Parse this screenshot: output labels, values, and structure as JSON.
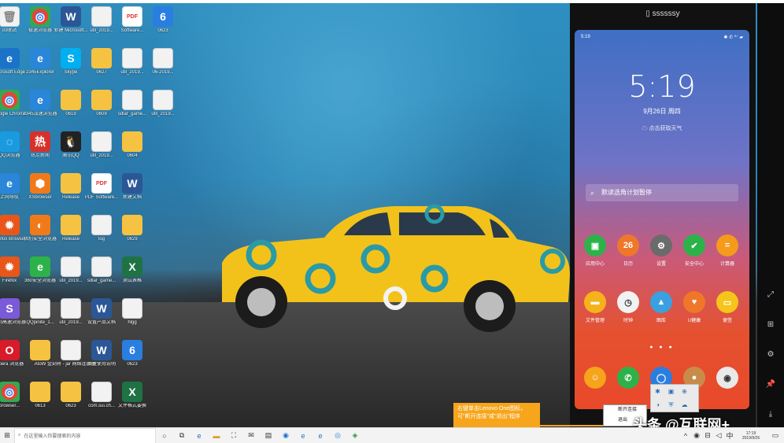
{
  "desktop": {
    "icons": [
      {
        "label": "回收站",
        "glyph": "🗑",
        "kind": "doc",
        "col": 0,
        "row": 0
      },
      {
        "label": "极速浏览器",
        "glyph": "◎",
        "kind": "chrome",
        "col": 1,
        "row": 0
      },
      {
        "label": "新建 Microsoft...",
        "glyph": "W",
        "kind": "word",
        "col": 2,
        "row": 0
      },
      {
        "label": "util_2019...",
        "glyph": "",
        "kind": "doc",
        "col": 3,
        "row": 0
      },
      {
        "label": "Software...",
        "glyph": "PDF",
        "kind": "pdf",
        "col": 4,
        "row": 0
      },
      {
        "label": "0623",
        "glyph": "6",
        "kind": "blue",
        "col": 5,
        "row": 0
      },
      {
        "label": "Microsoft Edge",
        "glyph": "e",
        "kind": "edge",
        "col": 0,
        "row": 1
      },
      {
        "label": "2345Explorer",
        "glyph": "e",
        "kind": "ie",
        "col": 1,
        "row": 1
      },
      {
        "label": "Skype",
        "glyph": "S",
        "kind": "skype",
        "col": 2,
        "row": 1
      },
      {
        "label": "0627",
        "glyph": "",
        "kind": "fold",
        "col": 3,
        "row": 1
      },
      {
        "label": "util_2019...",
        "glyph": "",
        "kind": "doc",
        "col": 4,
        "row": 1
      },
      {
        "label": "06-2019...",
        "glyph": "",
        "kind": "doc",
        "col": 5,
        "row": 1
      },
      {
        "label": "Google Chrome",
        "glyph": "◎",
        "kind": "chrome",
        "col": 0,
        "row": 2
      },
      {
        "label": "2345加速浏览器",
        "glyph": "e",
        "kind": "ie",
        "col": 1,
        "row": 2
      },
      {
        "label": "0619",
        "glyph": "",
        "kind": "fold",
        "col": 2,
        "row": 2
      },
      {
        "label": "0609",
        "glyph": "",
        "kind": "fold",
        "col": 3,
        "row": 2
      },
      {
        "label": "sdlar_game...",
        "glyph": "",
        "kind": "doc",
        "col": 4,
        "row": 2
      },
      {
        "label": "util_2019...",
        "glyph": "",
        "kind": "doc",
        "col": 5,
        "row": 2
      },
      {
        "label": "QQ浏览器",
        "glyph": "◌",
        "kind": "qqb",
        "col": 0,
        "row": 3
      },
      {
        "label": "热点新闻",
        "glyph": "热",
        "kind": "red",
        "col": 1,
        "row": 3
      },
      {
        "label": "腾讯QQ",
        "glyph": "🐧",
        "kind": "qq",
        "col": 2,
        "row": 3
      },
      {
        "label": "util_2019...",
        "glyph": "",
        "kind": "doc",
        "col": 3,
        "row": 3
      },
      {
        "label": "0604",
        "glyph": "",
        "kind": "fold",
        "col": 4,
        "row": 3
      },
      {
        "label": "上网导航",
        "glyph": "e",
        "kind": "ie",
        "col": 0,
        "row": 4
      },
      {
        "label": "XSbrowser",
        "glyph": "⬢",
        "kind": "orange",
        "col": 1,
        "row": 4
      },
      {
        "label": "Release",
        "glyph": "",
        "kind": "fold",
        "col": 2,
        "row": 4
      },
      {
        "label": "PDF Software...",
        "glyph": "PDF",
        "kind": "pdf",
        "col": 3,
        "row": 4
      },
      {
        "label": "新建文档",
        "glyph": "W",
        "kind": "word",
        "col": 4,
        "row": 4
      },
      {
        "label": "Firefox Browser",
        "glyph": "✹",
        "kind": "firefox",
        "col": 0,
        "row": 5
      },
      {
        "label": "猎豹安全浏览器",
        "glyph": "◐",
        "kind": "orange",
        "col": 1,
        "row": 5
      },
      {
        "label": "Release",
        "glyph": "",
        "kind": "fold",
        "col": 2,
        "row": 5
      },
      {
        "label": "log",
        "glyph": "",
        "kind": "doc",
        "col": 3,
        "row": 5
      },
      {
        "label": "0629",
        "glyph": "",
        "kind": "fold",
        "col": 4,
        "row": 5
      },
      {
        "label": "Firefox",
        "glyph": "✹",
        "kind": "firefox",
        "col": 0,
        "row": 6
      },
      {
        "label": "360安全浏览器",
        "glyph": "e",
        "kind": "green",
        "col": 1,
        "row": 6
      },
      {
        "label": "util_2019...",
        "glyph": "",
        "kind": "doc",
        "col": 2,
        "row": 6
      },
      {
        "label": "sdlar_game...",
        "glyph": "",
        "kind": "doc",
        "col": 3,
        "row": 6
      },
      {
        "label": "测试表格",
        "glyph": "X",
        "kind": "xls",
        "col": 4,
        "row": 6
      },
      {
        "label": "搜狗高速浏览器",
        "glyph": "S",
        "kind": "multi",
        "col": 0,
        "row": 7
      },
      {
        "label": "QQpinite_1...",
        "glyph": "",
        "kind": "doc",
        "col": 1,
        "row": 7
      },
      {
        "label": "util_2019...",
        "glyph": "",
        "kind": "doc",
        "col": 2,
        "row": 7
      },
      {
        "label": "设置产品文档",
        "glyph": "W",
        "kind": "word",
        "col": 3,
        "row": 7
      },
      {
        "label": "hlgg",
        "glyph": "",
        "kind": "doc",
        "col": 4,
        "row": 7
      },
      {
        "label": "Opera 浏览器",
        "glyph": "O",
        "kind": "opera",
        "col": 0,
        "row": 8
      },
      {
        "label": "AtoW",
        "glyph": "",
        "kind": "fold",
        "col": 1,
        "row": 8
      },
      {
        "label": "金刻将 - jar 网络连接器",
        "glyph": "",
        "kind": "doc",
        "col": 2,
        "row": 8
      },
      {
        "label": "质量使用说明",
        "glyph": "W",
        "kind": "word",
        "col": 3,
        "row": 8
      },
      {
        "label": "0623",
        "glyph": "6",
        "kind": "blue",
        "col": 4,
        "row": 8
      },
      {
        "label": "browser...",
        "glyph": "◎",
        "kind": "chrome",
        "col": 0,
        "row": 9
      },
      {
        "label": "0613",
        "glyph": "",
        "kind": "fold",
        "col": 1,
        "row": 9
      },
      {
        "label": "0623",
        "glyph": "",
        "kind": "fold",
        "col": 2,
        "row": 9
      },
      {
        "label": "com.sui.ch...",
        "glyph": "",
        "kind": "doc",
        "col": 3,
        "row": 9
      },
      {
        "label": "文件格式要换",
        "glyph": "X",
        "kind": "xls",
        "col": 4,
        "row": 9
      }
    ]
  },
  "phone": {
    "device_name": "ssssssy",
    "status_time": "5:19",
    "status_right": "✱ ✆ ⁰ᐟ ▰",
    "clock": "5:19",
    "date": "9月26日  周四",
    "weather": "点击获取天气",
    "search_placeholder": "默读选角计划暂停",
    "page_dots": "● ● ●",
    "apps_row1": [
      {
        "label": "应用中心",
        "color": "#2db24a",
        "glyph": "▣",
        "badge": "22"
      },
      {
        "label": "日历",
        "color": "#f0762a",
        "glyph": "26"
      },
      {
        "label": "设置",
        "color": "#6b6b6b",
        "glyph": "⚙"
      },
      {
        "label": "安全中心",
        "color": "#2bb34a",
        "glyph": "✔"
      },
      {
        "label": "计算器",
        "color": "#f59a1b",
        "glyph": "="
      }
    ],
    "apps_row2": [
      {
        "label": "文件管理",
        "color": "#f6b21b",
        "glyph": "▬"
      },
      {
        "label": "时钟",
        "color": "#f2f2f2",
        "glyph": "◷"
      },
      {
        "label": "图库",
        "color": "#3aa0e0",
        "glyph": "▲"
      },
      {
        "label": "U健康",
        "color": "#f0762a",
        "glyph": "♥"
      },
      {
        "label": "便签",
        "color": "#f6c51b",
        "glyph": "▭"
      }
    ],
    "dock": [
      {
        "color": "#f6a41b",
        "glyph": "☺"
      },
      {
        "color": "#2db24a",
        "glyph": "✆"
      },
      {
        "color": "#2a7ee0",
        "glyph": "◯"
      },
      {
        "color": "#c98b4a",
        "glyph": "●"
      },
      {
        "color": "#e9e9e9",
        "glyph": "◉"
      }
    ]
  },
  "side_buttons": [
    "⤢",
    "⊞",
    "⚙",
    "📌",
    "⤓"
  ],
  "callout": {
    "text": "右键单击Lenovo One图标，可\"断开连接\"或\"退出\"程序"
  },
  "context_menu": {
    "items": [
      "断开连接",
      "退出"
    ]
  },
  "taskbar": {
    "start": "⊞",
    "search_placeholder": "在这里输入你要搜索的内容",
    "tray_text": "中",
    "time": "17:19",
    "date": "2019/9/26"
  },
  "watermark": "头条 @互联网+"
}
